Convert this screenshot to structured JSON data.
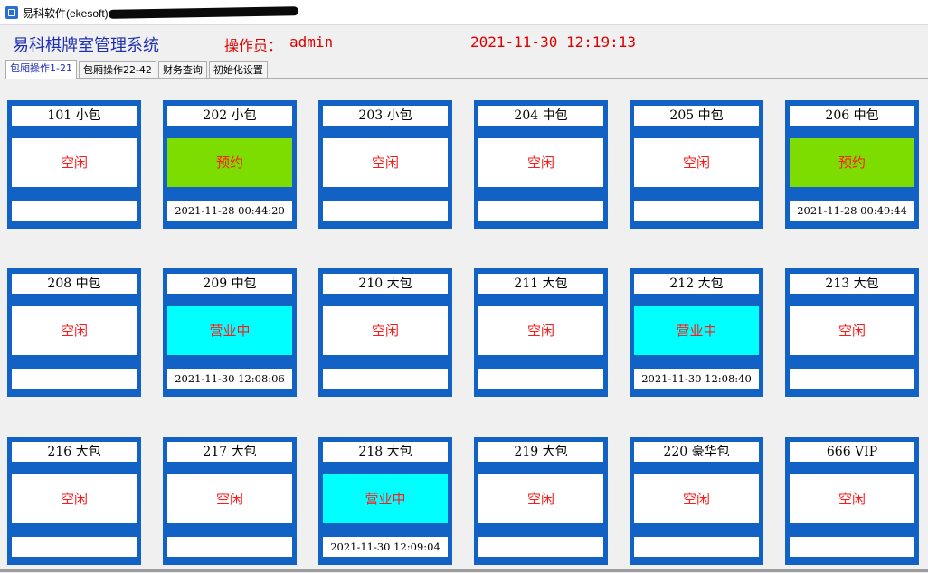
{
  "window": {
    "title": "易科软件(ekesoft)"
  },
  "header": {
    "app_name": "易科棋牌室管理系统",
    "operator_label": "操作员：",
    "operator_value": "admin",
    "datetime": "2021-11-30 12:19:13"
  },
  "tabs": [
    {
      "label": "包厢操作1-21",
      "active": true
    },
    {
      "label": "包厢操作22-42",
      "active": false
    },
    {
      "label": "财务查询",
      "active": false
    },
    {
      "label": "初始化设置",
      "active": false
    }
  ],
  "colors": {
    "room_border": "#1261c4",
    "status_idle_bg": "#ffffff",
    "status_reserved_bg": "#7ddc00",
    "status_busy_bg": "#00ffff",
    "status_text": "#ff1a1a",
    "app_name": "#1f2fb3"
  },
  "rooms": [
    {
      "name": "101  小包",
      "status": "空闲",
      "time": ""
    },
    {
      "name": "202  小包",
      "status": "预约",
      "time": "2021-11-28 00:44:20"
    },
    {
      "name": "203  小包",
      "status": "空闲",
      "time": ""
    },
    {
      "name": "204  中包",
      "status": "空闲",
      "time": ""
    },
    {
      "name": "205  中包",
      "status": "空闲",
      "time": ""
    },
    {
      "name": "206  中包",
      "status": "预约",
      "time": "2021-11-28 00:49:44"
    },
    {
      "name": "208  中包",
      "status": "空闲",
      "time": ""
    },
    {
      "name": "209  中包",
      "status": "营业中",
      "time": "2021-11-30 12:08:06"
    },
    {
      "name": "210  大包",
      "status": "空闲",
      "time": ""
    },
    {
      "name": "211  大包",
      "status": "空闲",
      "time": ""
    },
    {
      "name": "212  大包",
      "status": "营业中",
      "time": "2021-11-30 12:08:40"
    },
    {
      "name": "213  大包",
      "status": "空闲",
      "time": ""
    },
    {
      "name": "216  大包",
      "status": "空闲",
      "time": ""
    },
    {
      "name": "217  大包",
      "status": "空闲",
      "time": ""
    },
    {
      "name": "218  大包",
      "status": "营业中",
      "time": "2021-11-30 12:09:04"
    },
    {
      "name": "219  大包",
      "status": "空闲",
      "time": ""
    },
    {
      "name": "220  豪华包",
      "status": "空闲",
      "time": ""
    },
    {
      "name": "666  VIP",
      "status": "空闲",
      "time": ""
    }
  ]
}
